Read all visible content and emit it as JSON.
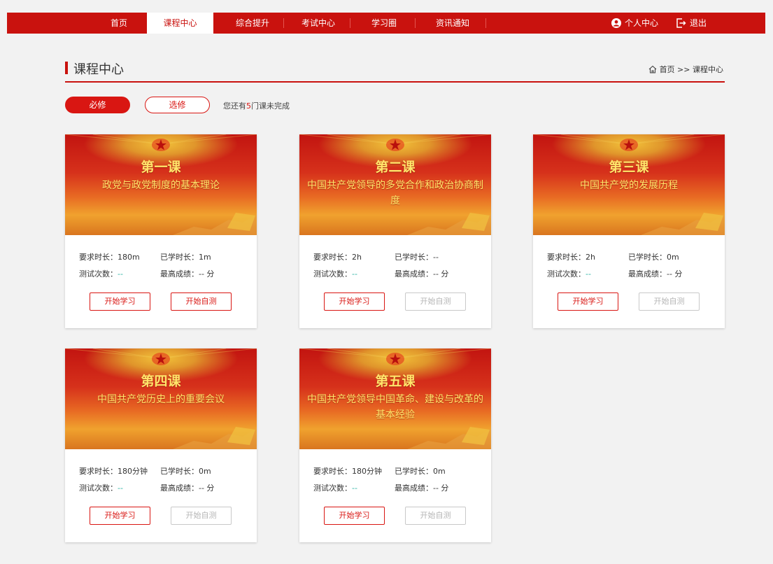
{
  "nav": {
    "items": [
      "首页",
      "课程中心",
      "综合提升",
      "考试中心",
      "学习圈",
      "资讯通知"
    ],
    "profile": "个人中心",
    "logout": "退出"
  },
  "page": {
    "title": "课程中心",
    "breadcrumb": "首页 >> 课程中心"
  },
  "filters": {
    "required": "必修",
    "elective": "选修",
    "hint_prefix": "您还有",
    "hint_count": "5",
    "hint_suffix": "门课未完成"
  },
  "labels": {
    "required_time": "要求时长：",
    "studied_time": "已学时长：",
    "test_count": "测试次数：",
    "best_score": "最高成绩：",
    "start_study": "开始学习",
    "start_test": "开始自测"
  },
  "courses": [
    {
      "lesson": "第一课",
      "subject": "政党与政党制度的基本理论",
      "required": "180m",
      "studied": "1m",
      "tests": "--",
      "score": "-- 分",
      "test_enabled": true
    },
    {
      "lesson": "第二课",
      "subject": "中国共产党领导的多党合作和政治协商制度",
      "required": "2h",
      "studied": "--",
      "tests": "--",
      "score": "-- 分",
      "test_enabled": false
    },
    {
      "lesson": "第三课",
      "subject": "中国共产党的发展历程",
      "required": "2h",
      "studied": "0m",
      "tests": "--",
      "score": "-- 分",
      "test_enabled": false
    },
    {
      "lesson": "第四课",
      "subject": "中国共产党历史上的重要会议",
      "required": "180分钟",
      "studied": "0m",
      "tests": "--",
      "score": "-- 分",
      "test_enabled": false
    },
    {
      "lesson": "第五课",
      "subject": "中国共产党领导中国革命、建设与改革的基本经验",
      "required": "180分钟",
      "studied": "0m",
      "tests": "--",
      "score": "-- 分",
      "test_enabled": false
    }
  ],
  "colors": {
    "brand_red": "#c9120e",
    "accent_red": "#d91612",
    "dash_teal": "#2bb3a3"
  }
}
